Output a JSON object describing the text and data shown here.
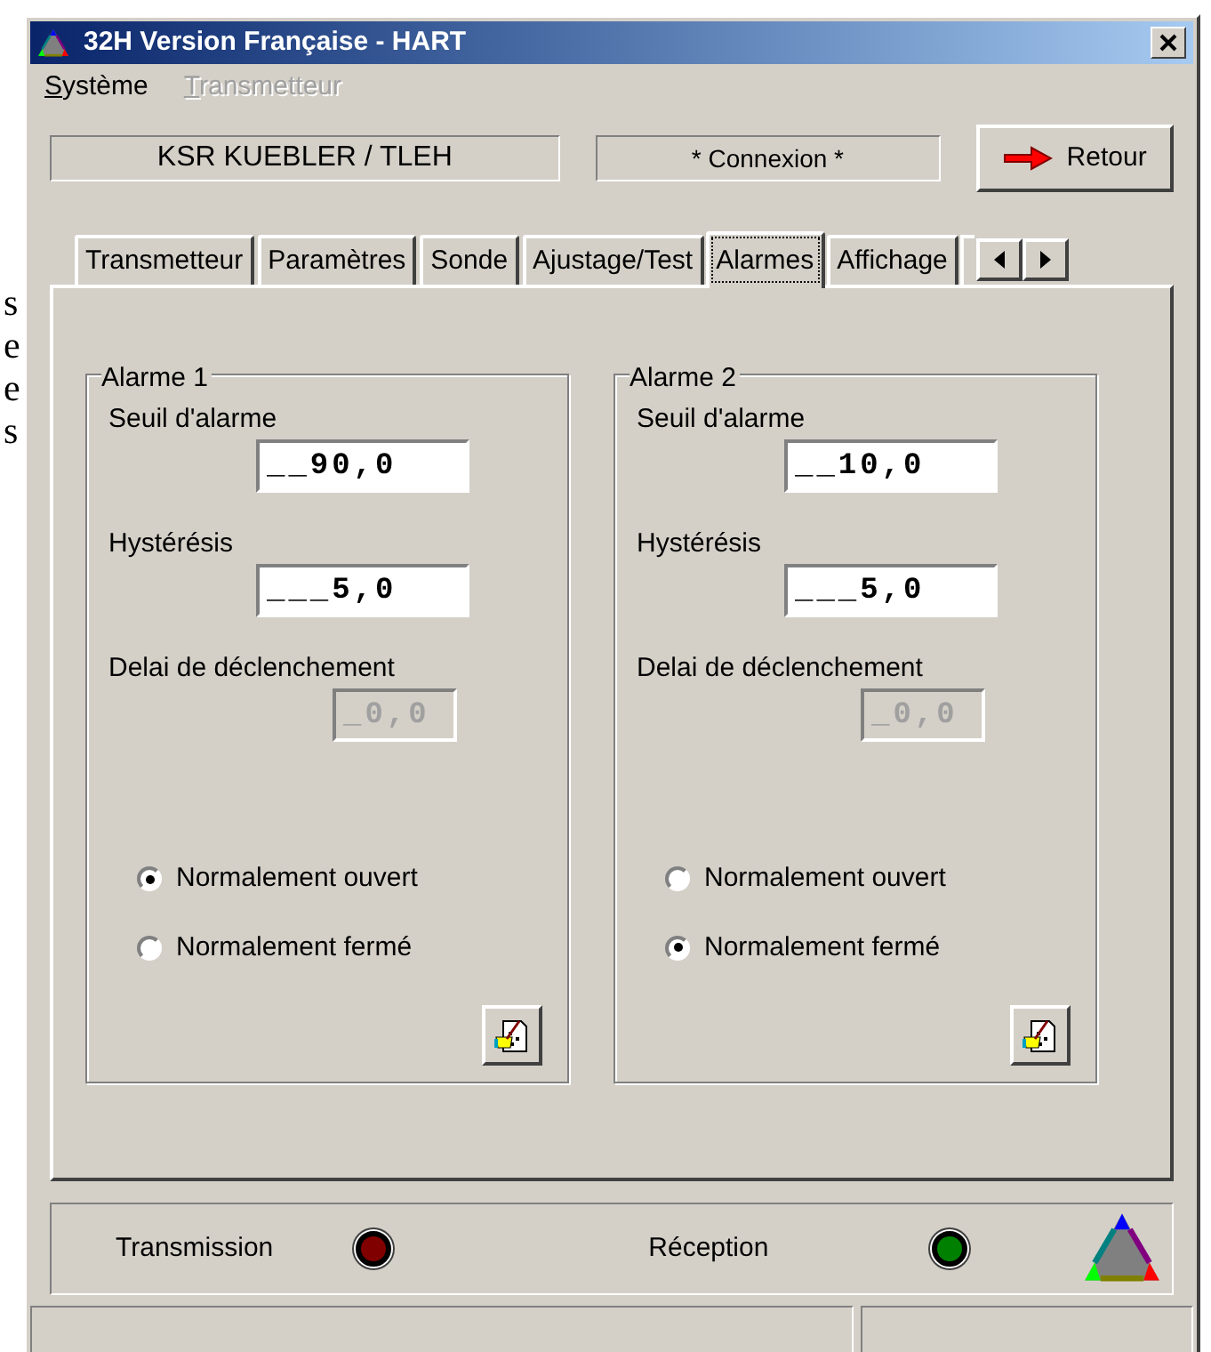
{
  "background_fragments": [
    "s",
    "e",
    "e",
    "s"
  ],
  "window": {
    "title": "32H Version Française - HART"
  },
  "menu": [
    {
      "label": "Système",
      "disabled": false
    },
    {
      "label": "Transmetteur",
      "disabled": true
    }
  ],
  "device": "KSR KUEBLER / TLEH",
  "connection": "* Connexion *",
  "back_button": "Retour",
  "tabs": [
    {
      "label": "Transmetteur",
      "selected": false
    },
    {
      "label": "Paramètres",
      "selected": false
    },
    {
      "label": "Sonde",
      "selected": false
    },
    {
      "label": "Ajustage/Test",
      "selected": false
    },
    {
      "label": "Alarmes",
      "selected": true
    },
    {
      "label": "Affichage",
      "selected": false
    }
  ],
  "alarms": [
    {
      "title": "Alarme 1",
      "fields": [
        {
          "label": "Seuil d'alarme",
          "value": "__90,0",
          "disabled": false
        },
        {
          "label": "Hystérésis",
          "value": "___5,0",
          "disabled": false
        },
        {
          "label": "Delai de déclenchement",
          "value": "_0,0",
          "disabled": true
        }
      ],
      "options": [
        {
          "label": "Normalement ouvert",
          "selected": true
        },
        {
          "label": "Normalement fermé",
          "selected": false
        }
      ]
    },
    {
      "title": "Alarme 2",
      "fields": [
        {
          "label": "Seuil d'alarme",
          "value": "__10,0",
          "disabled": false
        },
        {
          "label": "Hystérésis",
          "value": "___5,0",
          "disabled": false
        },
        {
          "label": "Delai de déclenchement",
          "value": "_0,0",
          "disabled": true
        }
      ],
      "options": [
        {
          "label": "Normalement ouvert",
          "selected": false
        },
        {
          "label": "Normalement fermé",
          "selected": true
        }
      ]
    }
  ],
  "indicators": [
    {
      "label": "Transmission",
      "color": "#800000"
    },
    {
      "label": "Réception",
      "color": "#008000"
    }
  ]
}
